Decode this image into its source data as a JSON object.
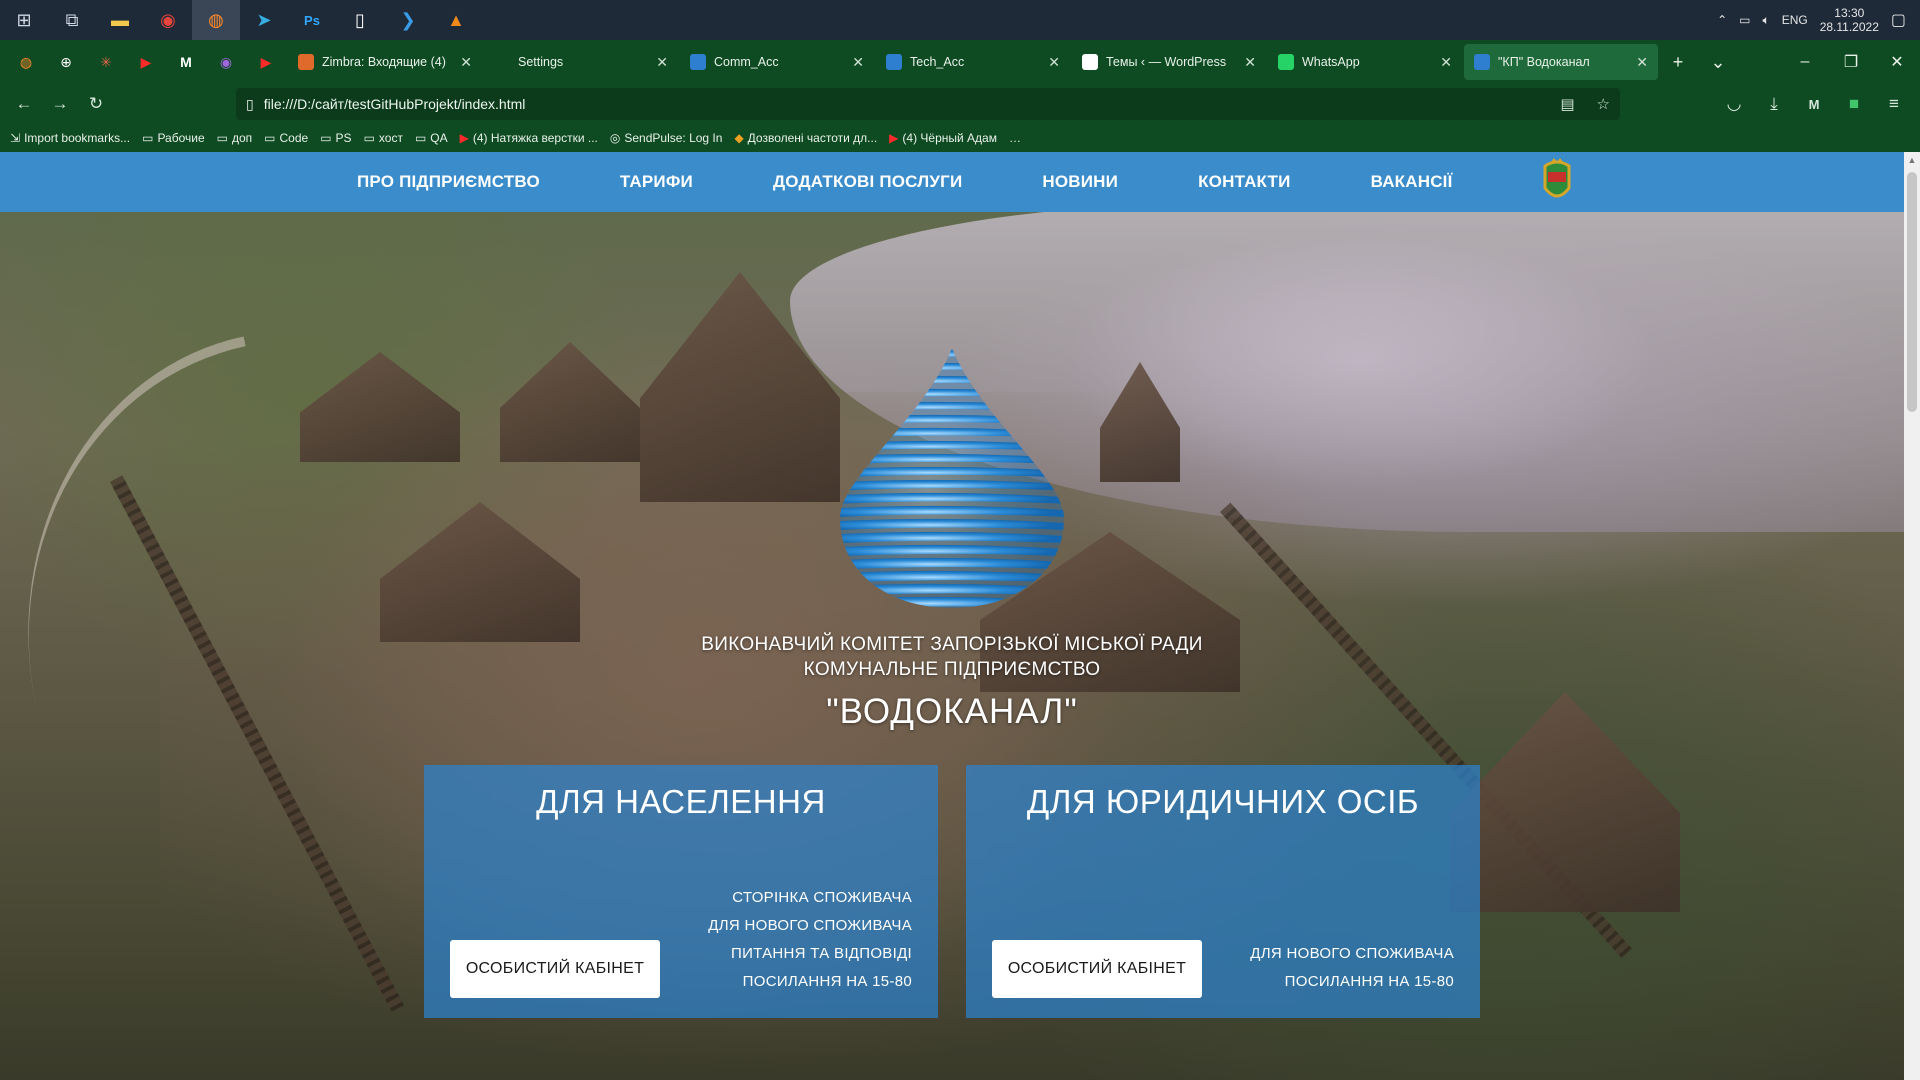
{
  "taskbar": {
    "apps": [
      {
        "name": "windows-start-icon",
        "glyph": "⊞"
      },
      {
        "name": "task-view-icon",
        "glyph": "⧉"
      },
      {
        "name": "file-explorer-icon",
        "glyph": "▬"
      },
      {
        "name": "chrome-icon",
        "glyph": "◉"
      },
      {
        "name": "firefox-icon",
        "glyph": "◍"
      },
      {
        "name": "telegram-icon",
        "glyph": "➤"
      },
      {
        "name": "photoshop-icon",
        "glyph": "Ps"
      },
      {
        "name": "notepad-icon",
        "glyph": "▯"
      },
      {
        "name": "vscode-icon",
        "glyph": "❯"
      },
      {
        "name": "vlc-icon",
        "glyph": "▲"
      }
    ],
    "tray_lang": "ENG",
    "time": "13:30",
    "date": "28.11.2022"
  },
  "browser": {
    "tabs": [
      {
        "label": "Zimbra: Входящие (4)",
        "icon_color": "#e06a2c"
      },
      {
        "label": "Settings",
        "icon_color": "#0e4a22"
      },
      {
        "label": "Comm_Acc",
        "icon_color": "#2f7fd0"
      },
      {
        "label": "Tech_Acc",
        "icon_color": "#2f7fd0"
      },
      {
        "label": "Темы ‹ — WordPress",
        "icon_color": "#ffffff"
      },
      {
        "label": "WhatsApp",
        "icon_color": "#25d366"
      },
      {
        "label": "\"КП\" Водоканал",
        "icon_color": "#2f7fd0",
        "active": true
      }
    ],
    "url": "file:///D:/сайт/testGitHubProjekt/index.html",
    "bookmarks": [
      {
        "label": "Import bookmarks...",
        "icon": "⇲"
      },
      {
        "label": "Рабочие",
        "icon": "▭"
      },
      {
        "label": "доп",
        "icon": "▭"
      },
      {
        "label": "Code",
        "icon": "▭"
      },
      {
        "label": "PS",
        "icon": "▭"
      },
      {
        "label": "хост",
        "icon": "▭"
      },
      {
        "label": "QA",
        "icon": "▭"
      },
      {
        "label": "(4) Натяжка верстки ...",
        "icon": "▶"
      },
      {
        "label": "SendPulse: Log In",
        "icon": "◎"
      },
      {
        "label": "Дозволені частоти дл...",
        "icon": "◆"
      },
      {
        "label": "(4) Чёрный Адам",
        "icon": "▶"
      }
    ]
  },
  "site": {
    "nav": [
      "ПРО ПІДПРИЄМСТВО",
      "ТАРИФИ",
      "ДОДАТКОВІ ПОСЛУГИ",
      "НОВИНИ",
      "КОНТАКТИ",
      "ВАКАНСІЇ"
    ],
    "org_line_1": "ВИКОНАВЧИЙ КОМІТЕТ ЗАПОРІЗЬКОЇ МІСЬКОЇ РАДИ",
    "org_line_2": "КОМУНАЛЬНЕ ПІДПРИЄМСТВО",
    "org_name": "\"ВОДОКАНАЛ\"",
    "cards": [
      {
        "title": "ДЛЯ НАСЕЛЕННЯ",
        "button": "ОСОБИСТИЙ КАБІНЕТ",
        "links": [
          "СТОРІНКА СПОЖИВАЧА",
          "ДЛЯ НОВОГО СПОЖИВАЧА",
          "ПИТАННЯ ТА ВІДПОВІДІ",
          "ПОСИЛАННЯ НА 15-80"
        ]
      },
      {
        "title": "ДЛЯ ЮРИДИЧНИХ ОСІБ",
        "button": "ОСОБИСТИЙ КАБІНЕТ",
        "links": [
          "ДЛЯ НОВОГО СПОЖИВАЧА",
          "ПОСИЛАННЯ НА 15-80"
        ]
      }
    ],
    "colors": {
      "header": "#3b8ccb",
      "card": "#2d82cd",
      "drop_blue": "#1f7fc9"
    }
  }
}
